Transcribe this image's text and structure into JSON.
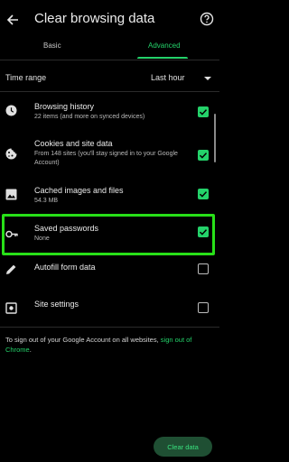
{
  "header": {
    "title": "Clear browsing data",
    "back_icon": "arrow-back-icon",
    "help_icon": "help-icon"
  },
  "tabs": [
    {
      "label": "Basic",
      "selected": false
    },
    {
      "label": "Advanced",
      "selected": true
    }
  ],
  "time_range": {
    "label": "Time range",
    "value": "Last hour",
    "icon": "caret-down-icon"
  },
  "items": [
    {
      "title": "Browsing history",
      "subtitle": "22 items (and more on synced devices)",
      "checked": true,
      "icon": "history-icon"
    },
    {
      "title": "Cookies and site data",
      "subtitle": "From 148 sites (you'll stay signed in to your Google Account)",
      "checked": true,
      "icon": "cookie-icon"
    },
    {
      "title": "Cached images and files",
      "subtitle": "54.3 MB",
      "checked": true,
      "icon": "image-icon"
    },
    {
      "title": "Saved passwords",
      "subtitle": "None",
      "checked": true,
      "icon": "key-icon"
    },
    {
      "title": "Autofill form data",
      "subtitle": "",
      "checked": false,
      "icon": "pencil-icon"
    },
    {
      "title": "Site settings",
      "subtitle": "",
      "checked": false,
      "icon": "settings-icon"
    }
  ],
  "signout": {
    "text": "To sign out of your Google Account on all websites, ",
    "link": "sign out of Chrome",
    "end": "."
  },
  "clear_button": {
    "label": "Clear data"
  },
  "colors": {
    "accent": "#24d26a",
    "highlight": "#28e018",
    "background": "#000000"
  }
}
